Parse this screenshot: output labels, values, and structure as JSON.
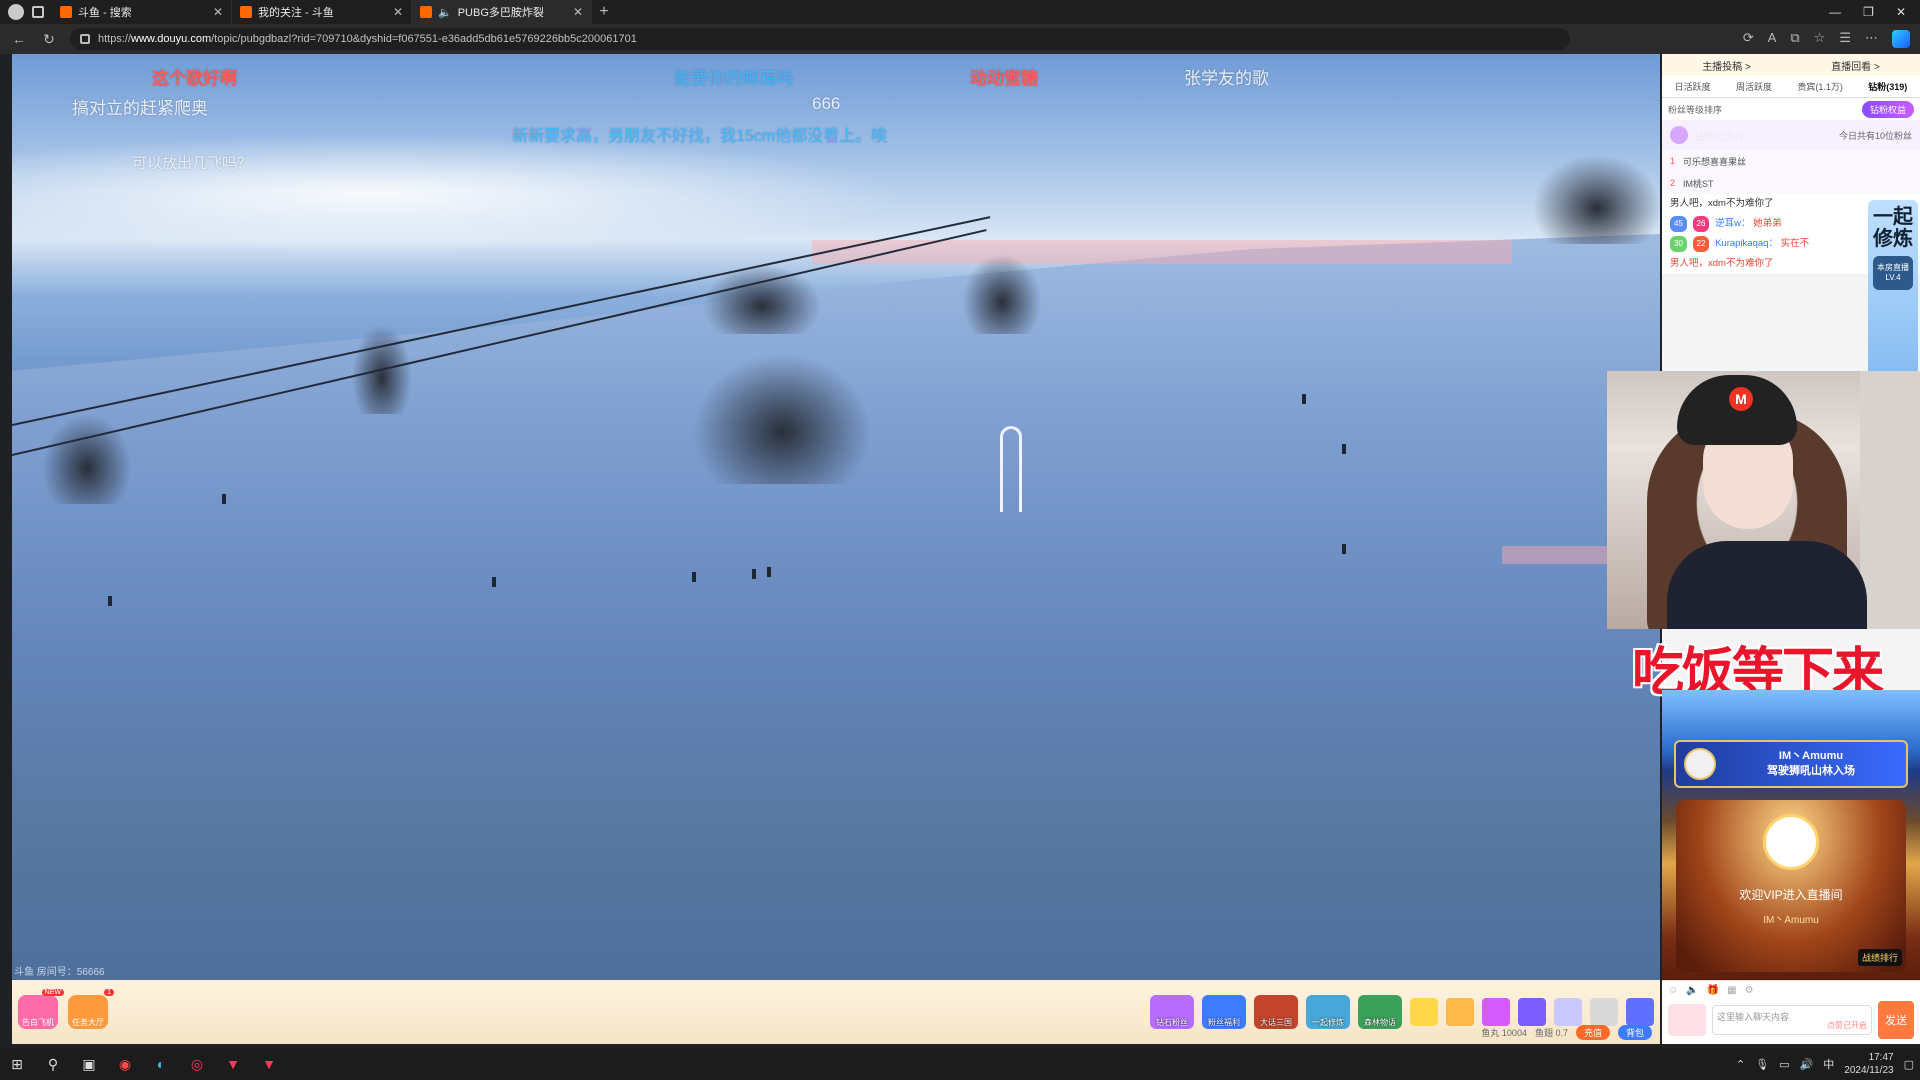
{
  "browser": {
    "tabs": [
      {
        "title": "斗鱼 - 搜索",
        "active": false
      },
      {
        "title": "我的关注 - 斗鱼",
        "active": false
      },
      {
        "title": "PUBG多巴胺炸裂",
        "active": true
      }
    ],
    "url_host": "www.douyu.com",
    "url_prefix": "https://",
    "url_path": "/topic/pubgdbazl?rid=709710&dyshid=f067551-e36add5db61e5769226bb5c200061701"
  },
  "video": {
    "danmu": [
      {
        "text": "这个歌好啊",
        "color": "#ff5a5a"
      },
      {
        "text": "搞对立的赶紧爬奥",
        "color": "#e8eef9"
      },
      {
        "text": "能要你的邮箱吗",
        "color": "#3fb7ff"
      },
      {
        "text": "666",
        "color": "#e8eef9"
      },
      {
        "text": "新新要求高，男朋友不好找，我15cm他都没看上。唉",
        "color": "#3fb7ff"
      },
      {
        "text": "动动蜜糖",
        "color": "#ff5a5a"
      },
      {
        "text": "张学友的歌",
        "color": "#e8eef9"
      },
      {
        "text": "可以放出几飞吗？",
        "color": "#e8eef9"
      }
    ],
    "room_label": "斗鱼 房间号：56666"
  },
  "right_panel": {
    "top_links": [
      "主播投稿 >",
      "直播回看 >"
    ],
    "rank_tabs": [
      "日活跃度",
      "周活跃度",
      "贵宾(1.1万)",
      "钻粉(319)"
    ],
    "fans_label": "粉丝等级排序",
    "fans_button": "钻粉权益",
    "anniversary_title": "钻粉纪念日",
    "anniversary_count": "今日共有10位粉丝",
    "ranks": [
      {
        "n": "1",
        "name": "可乐想喜喜果丝"
      },
      {
        "n": "2",
        "name": "IM桃ST"
      }
    ],
    "messages": [
      {
        "nick": "",
        "text": "男人吧，xdm不为难你了"
      },
      {
        "nick": "逆耳w：",
        "text": "她弟弟"
      },
      {
        "nick": "Kurapikaqaq：",
        "text": "实在不"
      },
      {
        "nick": "",
        "text": "男人吧，xdm不为难你了"
      }
    ],
    "side_big": "一起修炼",
    "side_lv": "本房直播 LV.4"
  },
  "overlay": {
    "banner": "吃饭等下来",
    "entry_name": "IM丶Amumu",
    "entry_action": "驾驶狮吼山林入场",
    "vip_text": "欢迎VIP进入直播间",
    "vip_name": "IM丶Amumu",
    "vip_tag": "战绩排行"
  },
  "bottom": {
    "left_items": [
      {
        "label": "告白飞机",
        "color": "#ff6ba8",
        "new": "NEW"
      },
      {
        "label": "任务大厅",
        "color": "#ff9a3c",
        "new": "1"
      }
    ],
    "gifts": [
      {
        "label": "钻石粉丝",
        "color": "#b66cff"
      },
      {
        "label": "粉丝福利",
        "color": "#3d7bff"
      },
      {
        "label": "大话三国",
        "color": "#c2442b"
      },
      {
        "label": "一起修炼",
        "color": "#47a7d8"
      },
      {
        "label": "森林物语",
        "color": "#3aa05a"
      }
    ],
    "small_gifts": [
      "#ffd84a",
      "#ffb84a",
      "#d45cff",
      "#7a5cff",
      "#c9c9ff",
      "#d8d8d8",
      "#5f6fff"
    ],
    "yuwan": "鱼丸 10004",
    "yuchi": "鱼翅 0.7",
    "recharge": "充值",
    "bag": "背包"
  },
  "chat_input": {
    "placeholder": "这里输入聊天内容",
    "hint": "点赞已开启",
    "send": "发送"
  },
  "taskbar": {
    "time": "17:47",
    "date": "2024/11/23",
    "ime": "中"
  }
}
